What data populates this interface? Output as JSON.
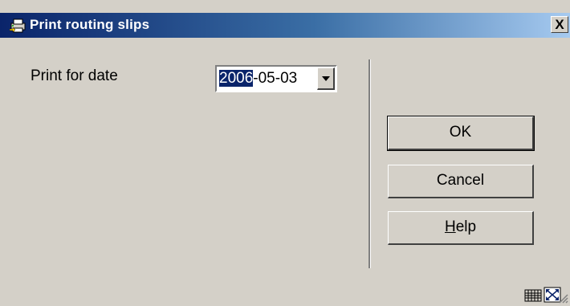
{
  "window": {
    "title": "Print routing slips",
    "close_label": "X"
  },
  "form": {
    "print_for_date_label": "Print for date",
    "date_value_selected": "2006",
    "date_value_rest": "-05-03"
  },
  "buttons": {
    "ok": "OK",
    "cancel": "Cancel",
    "help_first": "H",
    "help_rest": "elp"
  },
  "icons": {
    "title": "printer-routing-icon",
    "dropdown": "chevron-down-icon",
    "status_1": "keyboard-icon",
    "status_2": "resize-icon",
    "grip": "size-grip-icon"
  }
}
